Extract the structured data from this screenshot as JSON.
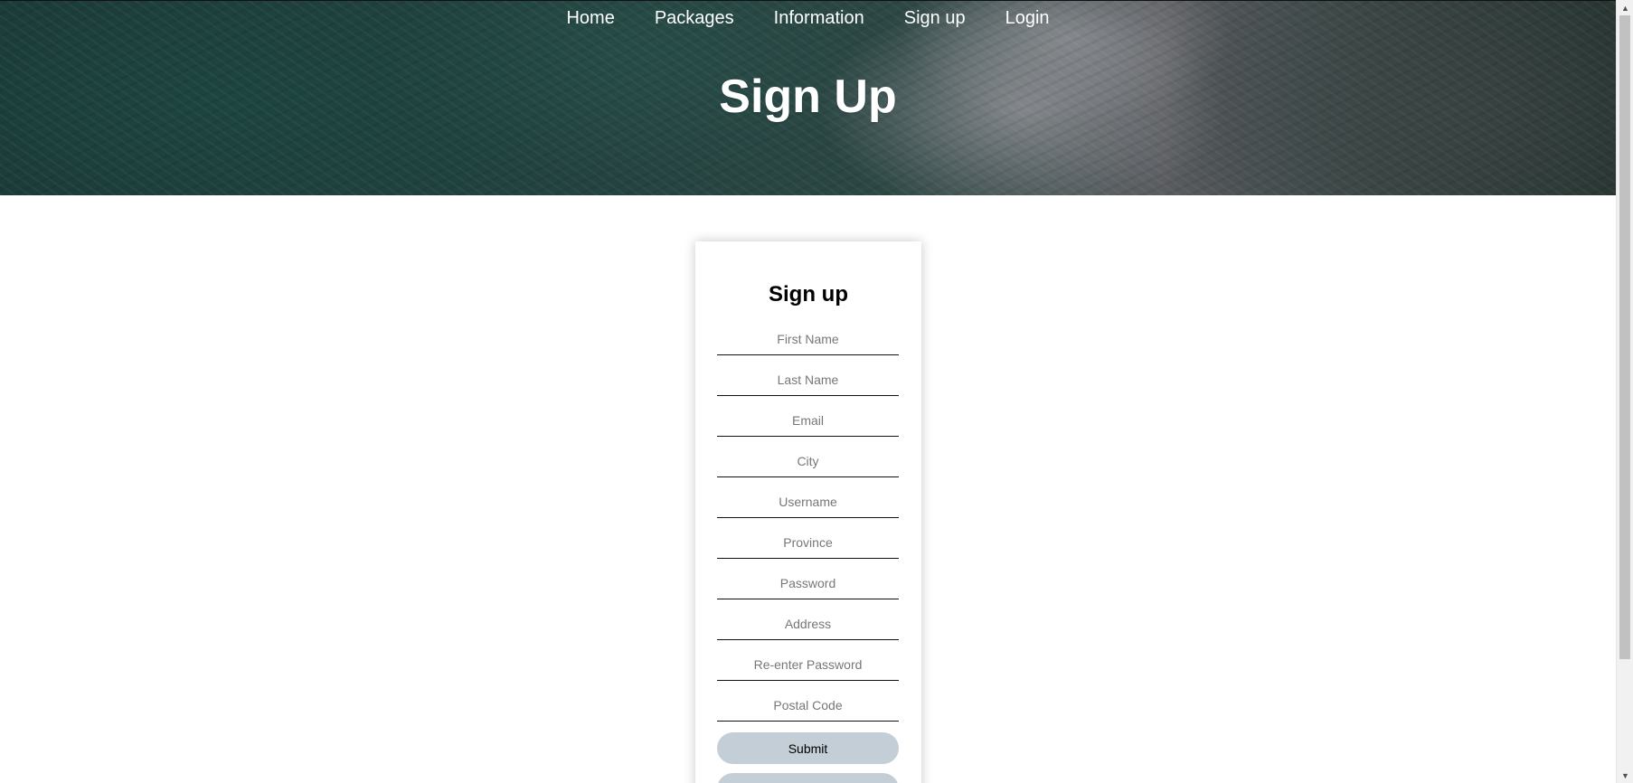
{
  "nav": {
    "items": [
      "Home",
      "Packages",
      "Information",
      "Sign up",
      "Login"
    ]
  },
  "hero": {
    "title": "Sign Up"
  },
  "form": {
    "title": "Sign up",
    "fields": {
      "first_name": "First Name",
      "last_name": "Last Name",
      "email": "Email",
      "city": "City",
      "username": "Username",
      "province": "Province",
      "password": "Password",
      "address": "Address",
      "reenter_password": "Re-enter Password",
      "postal_code": "Postal Code"
    },
    "submit_label": "Submit",
    "second_button_label": ""
  },
  "colors": {
    "button_bg": "#c3ced6",
    "field_underline": "#111111",
    "placeholder": "#777777"
  }
}
